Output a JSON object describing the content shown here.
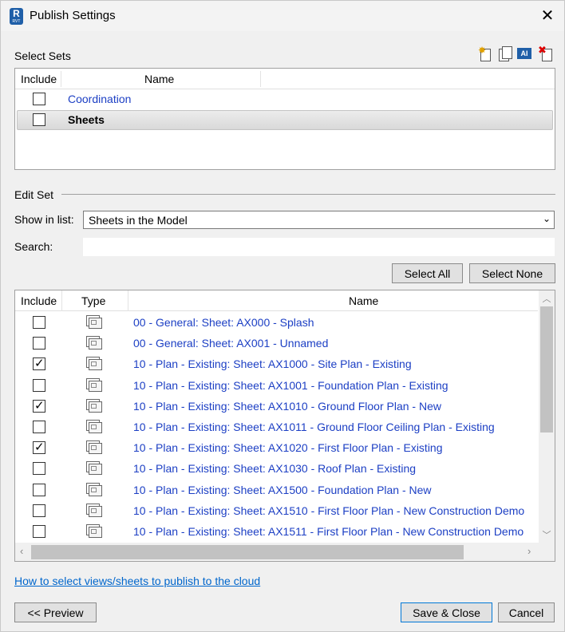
{
  "window": {
    "title": "Publish Settings",
    "app_icon_letter": "R",
    "app_icon_sub": "RVT"
  },
  "select_sets": {
    "label": "Select Sets",
    "toolbar_icons": [
      "new-set-icon",
      "duplicate-set-icon",
      "rename-set-icon",
      "delete-set-icon"
    ],
    "columns": {
      "include": "Include",
      "name": "Name"
    },
    "rows": [
      {
        "include": false,
        "name": "Coordination",
        "selected": false
      },
      {
        "include": false,
        "name": "Sheets",
        "selected": true
      }
    ]
  },
  "edit_set": {
    "label": "Edit Set",
    "show_in_list_label": "Show in list:",
    "show_in_list_value": "Sheets in the Model",
    "search_label": "Search:",
    "search_value": "",
    "select_all": "Select All",
    "select_none": "Select None",
    "columns": {
      "include": "Include",
      "type": "Type",
      "name": "Name"
    },
    "rows": [
      {
        "include": false,
        "type": "sheet-icon",
        "name": "00 - General: Sheet: AX000 - Splash"
      },
      {
        "include": false,
        "type": "sheet-icon",
        "name": "00 - General: Sheet: AX001 - Unnamed"
      },
      {
        "include": true,
        "type": "sheet-icon",
        "name": "10 - Plan - Existing: Sheet: AX1000 - Site Plan - Existing"
      },
      {
        "include": false,
        "type": "sheet-icon",
        "name": "10 - Plan - Existing: Sheet: AX1001 - Foundation Plan - Existing"
      },
      {
        "include": true,
        "type": "sheet-icon",
        "name": "10 - Plan - Existing: Sheet: AX1010 - Ground Floor Plan - New"
      },
      {
        "include": false,
        "type": "sheet-icon",
        "name": "10 - Plan - Existing: Sheet: AX1011 - Ground Floor Ceiling Plan - Existing"
      },
      {
        "include": true,
        "type": "sheet-icon",
        "name": "10 - Plan - Existing: Sheet: AX1020 - First Floor Plan - Existing"
      },
      {
        "include": false,
        "type": "sheet-icon",
        "name": "10 - Plan - Existing: Sheet: AX1030 - Roof Plan - Existing"
      },
      {
        "include": false,
        "type": "sheet-icon",
        "name": "10 - Plan - Existing: Sheet: AX1500 - Foundation Plan - New"
      },
      {
        "include": false,
        "type": "sheet-icon",
        "name": "10 - Plan - Existing: Sheet: AX1510 - First Floor Plan - New Construction Demo"
      },
      {
        "include": false,
        "type": "sheet-icon",
        "name": "10 - Plan - Existing: Sheet: AX1511 - First Floor Plan - New Construction Demo"
      }
    ]
  },
  "footer": {
    "help_link": "How to select views/sheets to publish to the cloud",
    "preview": "<< Preview",
    "save_close": "Save & Close",
    "cancel": "Cancel"
  },
  "colors": {
    "link": "#1c3fc4",
    "help_link": "#0066cc",
    "default_button_border": "#0078d7"
  }
}
